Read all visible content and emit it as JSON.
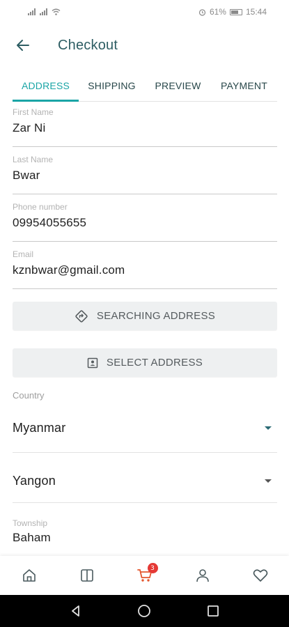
{
  "status": {
    "battery": "61%",
    "time": "15:44"
  },
  "app_bar": {
    "title": "Checkout"
  },
  "tabs": [
    {
      "label": "ADDRESS",
      "active": true
    },
    {
      "label": "SHIPPING",
      "active": false
    },
    {
      "label": "PREVIEW",
      "active": false
    },
    {
      "label": "PAYMENT",
      "active": false
    }
  ],
  "form": {
    "first_name": {
      "label": "First Name",
      "value": "Zar Ni"
    },
    "last_name": {
      "label": "Last Name",
      "value": "Bwar"
    },
    "phone": {
      "label": "Phone number",
      "value": "09954055655"
    },
    "email": {
      "label": "Email",
      "value": "kznbwar@gmail.com"
    }
  },
  "buttons": {
    "searching_address": "SEARCHING ADDRESS",
    "select_address": "SELECT ADDRESS"
  },
  "country": {
    "label": "Country",
    "value": "Myanmar"
  },
  "region": {
    "value": "Yangon"
  },
  "township": {
    "label": "Township",
    "value": "Baham"
  },
  "bottom_nav": {
    "cart_count": "3"
  },
  "colors": {
    "accent": "#1aa5a6",
    "title": "#2d5d63",
    "cart": "#e4572e",
    "badge": "#e53935"
  },
  "icons": [
    "back-arrow-icon",
    "directions-icon",
    "contact-card-icon",
    "home-icon",
    "categories-icon",
    "cart-icon",
    "user-icon",
    "heart-icon"
  ]
}
